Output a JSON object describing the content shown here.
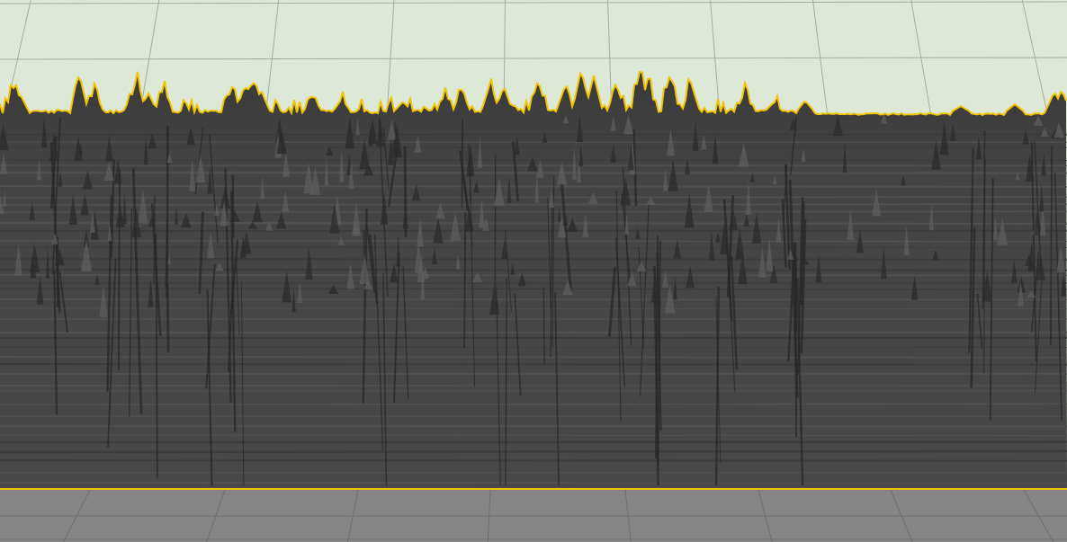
{
  "view": {
    "kind": "3D waveform / spectrogram height-field render",
    "colors": {
      "background": "#dde8d6",
      "background_grid": "#9aa598",
      "surface": "#454545",
      "surface_dark": "#2c2c2c",
      "surface_light": "#5a5a5a",
      "outline": "#f2c400",
      "floor": "#858585",
      "floor_grid": "#6b6b6b"
    }
  }
}
